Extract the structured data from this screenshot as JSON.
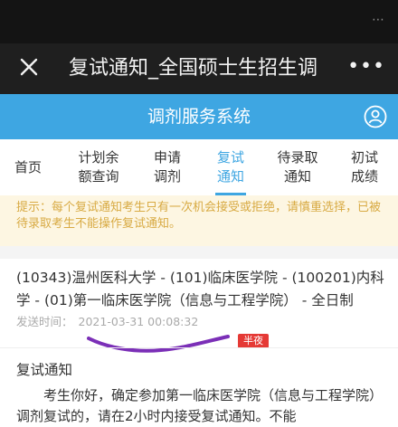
{
  "window": {
    "title": "复试通知_全国硕士生招生调",
    "close_icon": "close-icon",
    "more_icon": "more-icon"
  },
  "system": {
    "title": "调剂服务系统",
    "user_icon": "user-icon",
    "accent": "#3ea6e2"
  },
  "nav": {
    "tabs": [
      {
        "label": "首页"
      },
      {
        "label": "计划余\n额查询"
      },
      {
        "label": "申请\n调剂"
      },
      {
        "label": "复试\n通知",
        "active": true
      },
      {
        "label": "待录取\n通知"
      },
      {
        "label": "初试\n成绩"
      }
    ]
  },
  "tip": {
    "text": "提示：每个复试通知考生只有一次机会接受或拒绝，请慎重选择，已被待录取考生不能操作复试通知。",
    "color": "#d8aa43"
  },
  "notice": {
    "heading": "(10343)温州医科大学 - (101)临床医学院 - (100201)内科学 - (01)第一临床医学院（信息与工程学院） - 全日制",
    "send_time_label": "发送时间：",
    "send_time_value": "2021-03-31 00:08:32",
    "badge": "半夜",
    "badge_color": "#e53935"
  },
  "content": {
    "title": "复试通知",
    "body": "考生你好，确定参加第一临床医学院（信息与工程学院）调剂复试的，请在2小时内接受复试通知。不能"
  }
}
